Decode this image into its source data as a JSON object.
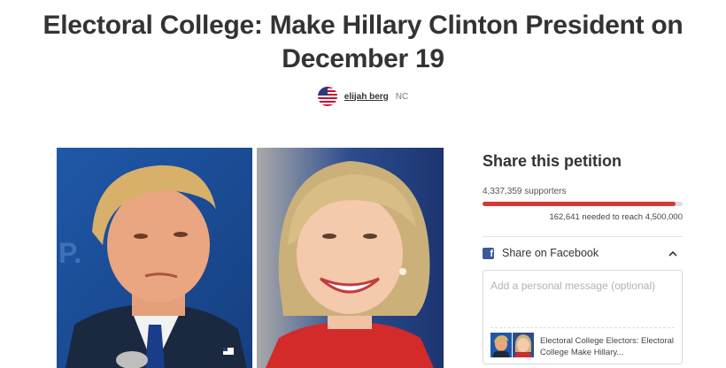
{
  "petition": {
    "title": "Electoral College: Make Hillary Clinton President on December 19",
    "author": {
      "name": "elijah berg",
      "location": "NC"
    }
  },
  "photos": [
    {
      "icon": "trump-photo"
    },
    {
      "icon": "clinton-photo"
    }
  ],
  "share": {
    "heading": "Share this petition",
    "supporters": "4,337,359 supporters",
    "progress_fraction": 0.964,
    "needed": "162,641 needed to reach 4,500,000",
    "facebook": {
      "label": "Share on Facebook",
      "placeholder": "Add a personal message (optional)",
      "preview_text": "Electoral College Electors: Electoral College Make Hillary..."
    }
  },
  "colors": {
    "accent": "#d53a30",
    "facebook": "#3b5998",
    "text": "#333333"
  }
}
